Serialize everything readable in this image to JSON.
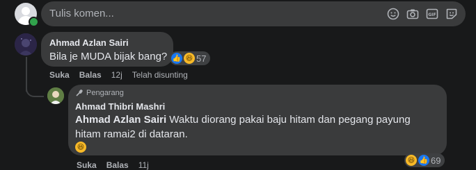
{
  "composer": {
    "placeholder": "Tulis komen..."
  },
  "comment": {
    "author": "Ahmad Azlan Sairi",
    "text": "Bila je MUDA bijak bang?",
    "reaction_count": "57",
    "actions": {
      "like": "Suka",
      "reply": "Balas"
    },
    "time": "12j",
    "edited": "Telah disunting"
  },
  "reply": {
    "badge": "Pengarang",
    "author": "Ahmad Thibri Mashri",
    "mention": "Ahmad Azlan Sairi",
    "text": " Waktu diorang pakai baju hitam dan pegang payung hitam ramai2 di dataran.",
    "reaction_count": "69",
    "actions": {
      "like": "Suka",
      "reply": "Balas"
    },
    "time": "11j"
  },
  "colors": {
    "background": "#18191a",
    "bubble": "#3a3b3c",
    "like_blue": "#1877f2",
    "laugh_yellow": "#f7b928",
    "online_green": "#31a24c"
  }
}
